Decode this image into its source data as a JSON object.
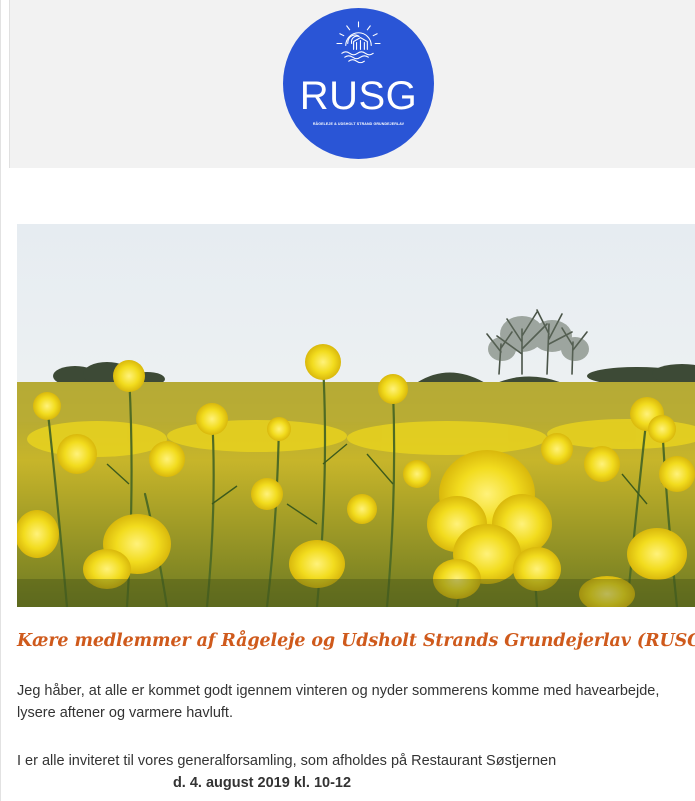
{
  "header": {
    "logo": {
      "text": "RUSG",
      "subtitle": "RÅGELEJE & UDSHOLT STRAND GRUNDEJERLAV",
      "emblem_icon": "beach-hut-sun-waves-icon",
      "color": "#2a55d6"
    },
    "band_color": "#f2f2f2"
  },
  "hero_image": {
    "subject": "rapeseed-field-photo"
  },
  "content": {
    "greeting": "Kære medlemmer af Rågeleje og Udsholt Strands Grundejerlav (RUSG),",
    "greeting_color": "#cf5a1c",
    "paragraph1": "Jeg håber, at alle er kommet godt igennem vinteren og nyder sommerens komme med havearbejde, lysere aftener og varmere havluft.",
    "paragraph2": "I er alle inviteret til vores generalforsamling, som afholdes på Restaurant Søstjernen",
    "date_line": "d. 4. august 2019 kl. 10-12"
  }
}
